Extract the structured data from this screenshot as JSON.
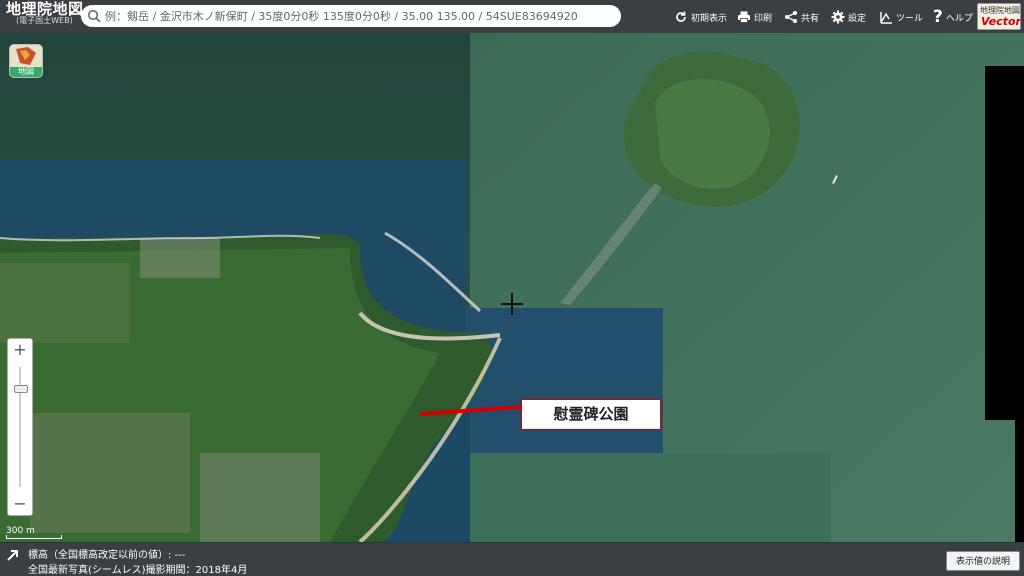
{
  "header": {
    "logo_title": "地理院地図",
    "logo_subtitle": "(電子国土WEB)",
    "search_placeholder": "例：剱岳 / 金沢市木ノ新保町 / 35度0分0秒 135度0分0秒 / 35.00 135.00 / 54SUE83694920",
    "buttons": {
      "initial_view": "初期表示",
      "print": "印刷",
      "share": "共有",
      "settings": "設定",
      "tools": "ツール",
      "help": "ヘルプ"
    },
    "vector_badge_top": "地理院地図",
    "vector_badge_main": "Vector"
  },
  "map": {
    "layer_button_label": "地図",
    "zoom_in": "+",
    "zoom_out": "−",
    "zoom_level_fraction": 0.85,
    "scale_label": "300 m",
    "annotation_label": "慰霊碑公園",
    "colors": {
      "sea_dark": "#1f4a5e",
      "sea_green": "#2f5a4c",
      "land": "#3f6b35",
      "leader_line": "#d40000"
    }
  },
  "footer": {
    "elevation_line": "標高（全国標高改定以前の値）: ---",
    "photo_line": "全国最新写真(シームレス)撮影期間：2018年4月",
    "explain_button": "表示値の説明"
  }
}
